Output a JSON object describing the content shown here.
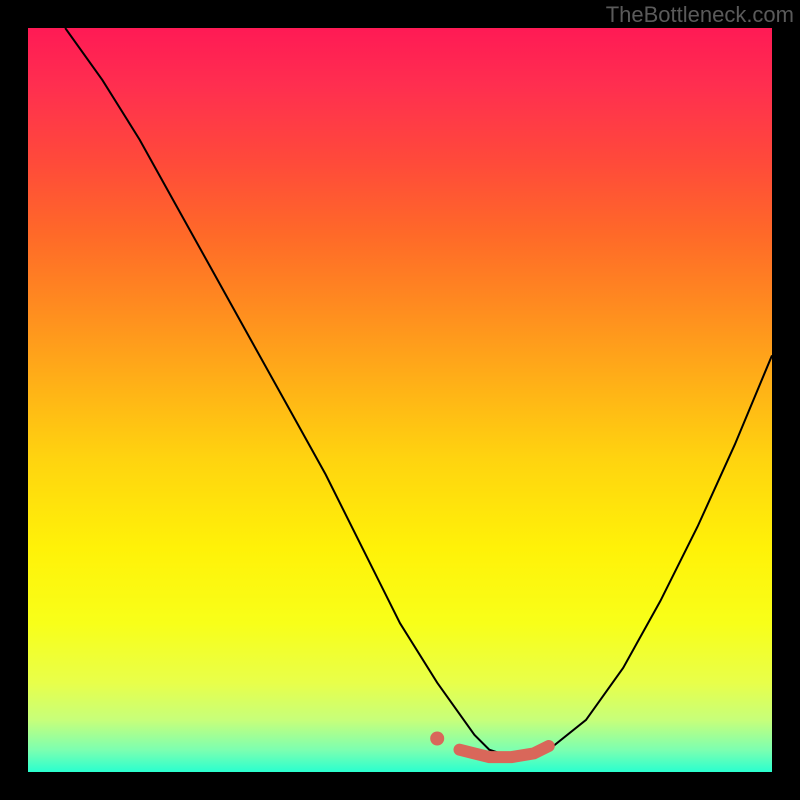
{
  "watermark": "TheBottleneck.com",
  "chart_data": {
    "type": "line",
    "title": "",
    "xlabel": "",
    "ylabel": "",
    "xlim": [
      0,
      100
    ],
    "ylim": [
      0,
      100
    ],
    "grid": false,
    "series": [
      {
        "name": "curve",
        "color": "#000000",
        "x": [
          5,
          10,
          15,
          20,
          25,
          30,
          35,
          40,
          45,
          50,
          55,
          60,
          62,
          65,
          68,
          70,
          75,
          80,
          85,
          90,
          95,
          100
        ],
        "y": [
          100,
          93,
          85,
          76,
          67,
          58,
          49,
          40,
          30,
          20,
          12,
          5,
          3,
          2,
          2,
          3,
          7,
          14,
          23,
          33,
          44,
          56
        ]
      },
      {
        "name": "highlight",
        "color": "#d9675a",
        "x": [
          55,
          58,
          60,
          62,
          65,
          68,
          70
        ],
        "y": [
          4.5,
          3,
          2.5,
          2,
          2,
          2.5,
          3.5
        ]
      }
    ],
    "background_gradient": {
      "top": "#ff1a55",
      "middle": "#ffd40f",
      "bottom": "#2affcf"
    }
  }
}
